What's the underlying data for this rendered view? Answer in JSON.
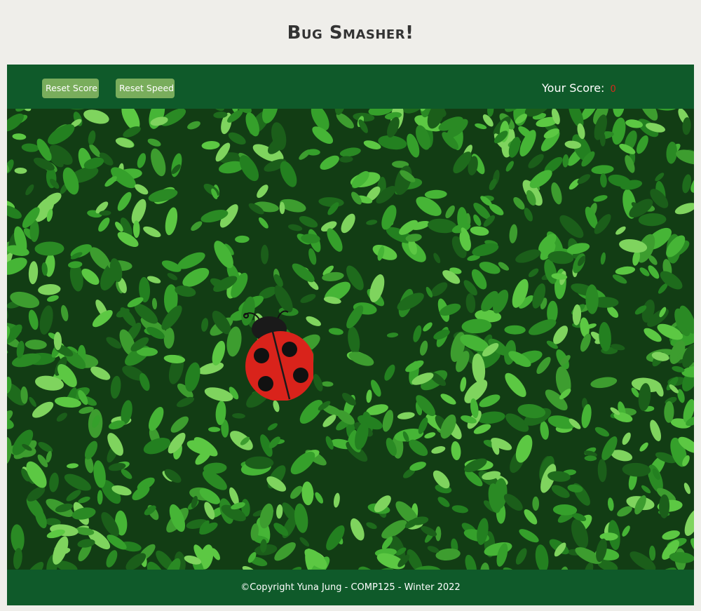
{
  "page": {
    "title": "Bug Smasher!"
  },
  "toolbar": {
    "reset_score_label": "Reset Score",
    "reset_speed_label": "Reset Speed",
    "score_label": "Your Score:",
    "score_value": "0"
  },
  "game": {
    "bug": "ladybug",
    "background": "green-leaves"
  },
  "footer": {
    "copyright": "©Copyright Yuna Jung - COMP125 - Winter 2022"
  },
  "colors": {
    "page_background": "#efeeea",
    "panel_green": "#0f5a2a",
    "button_green": "#79ad5c",
    "score_red": "#d62a1b",
    "ladybug_red": "#d9231b"
  }
}
